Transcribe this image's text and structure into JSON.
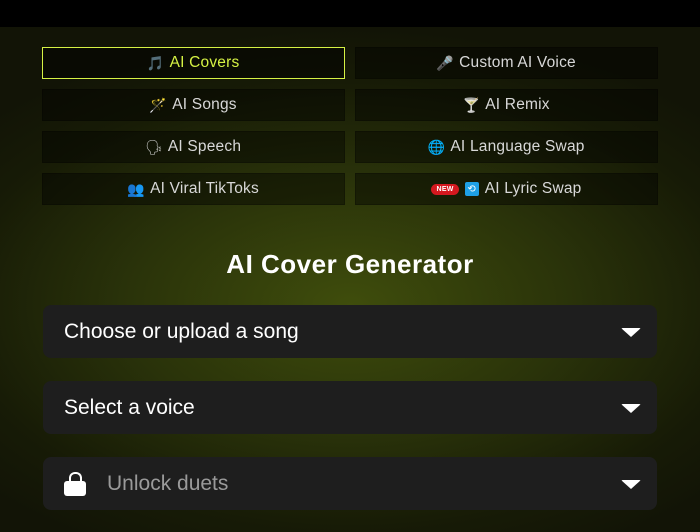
{
  "tabs": [
    {
      "label": "AI Covers",
      "icon": "music-note-icon",
      "glyph": "🎵"
    },
    {
      "label": "Custom AI Voice",
      "icon": "microphone-icon",
      "glyph": "🎤"
    },
    {
      "label": "AI Songs",
      "icon": "magic-wand-icon",
      "glyph": "🪄"
    },
    {
      "label": "AI Remix",
      "icon": "cocktail-icon",
      "glyph": "🍸"
    },
    {
      "label": "AI Speech",
      "icon": "speaking-head-icon",
      "glyph": "🗣"
    },
    {
      "label": "AI Language Swap",
      "icon": "globe-icon",
      "glyph": "🌐"
    },
    {
      "label": "AI Viral TikToks",
      "icon": "people-icon",
      "glyph": "👥"
    },
    {
      "label": "AI Lyric Swap",
      "icon": "swap-icon",
      "glyph": "🔄",
      "badge": "NEW"
    }
  ],
  "active_tab": "AI Covers",
  "title": "AI Cover Generator",
  "song_select": {
    "placeholder": "Choose or upload a song"
  },
  "voice_select": {
    "placeholder": "Select a voice"
  },
  "duet_select": {
    "placeholder": "Unlock duets",
    "icon": "lock-icon"
  },
  "colors": {
    "accent": "#d6f244",
    "badge": "#d4181f",
    "field_bg": "#1e1e1e"
  }
}
